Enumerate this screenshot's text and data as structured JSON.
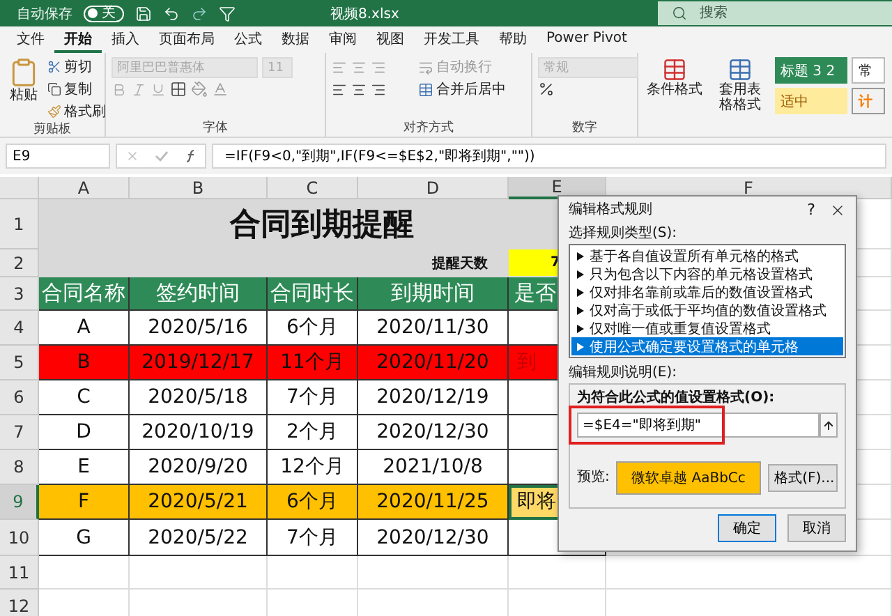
{
  "title_bar": {
    "autosave_label": "自动保存",
    "autosave_toggle": {
      "label": "关",
      "on": false
    },
    "file_name": "视频8.xlsx",
    "search": {
      "placeholder": "搜索"
    }
  },
  "ribbon_tabs": [
    {
      "label": "文件",
      "selected": false
    },
    {
      "label": "开始",
      "selected": true
    },
    {
      "label": "插入",
      "selected": false
    },
    {
      "label": "页面布局",
      "selected": false
    },
    {
      "label": "公式",
      "selected": false
    },
    {
      "label": "数据",
      "selected": false
    },
    {
      "label": "审阅",
      "selected": false
    },
    {
      "label": "视图",
      "selected": false
    },
    {
      "label": "开发工具",
      "selected": false
    },
    {
      "label": "帮助",
      "selected": false
    },
    {
      "label": "Power Pivot",
      "selected": false
    }
  ],
  "ribbon": {
    "clipboard": {
      "paste": "粘贴",
      "cut": "剪切",
      "copy": "复制",
      "format_painter": "格式刷",
      "label": "剪贴板"
    },
    "font": {
      "font_name": "阿里巴巴普惠体",
      "font_size": "11",
      "label": "字体"
    },
    "alignment": {
      "wrap_text": "自动换行",
      "merge_center": "合并后居中",
      "label": "对齐方式"
    },
    "number": {
      "format": "常规",
      "label": "数字"
    },
    "styles": {
      "conditional_format": "条件格式",
      "table_format": "套用表格格式",
      "cell_styles": [
        {
          "label": "标题 3 2",
          "kind": "heading"
        },
        {
          "label": "常",
          "kind": "normal"
        },
        {
          "label": "适中",
          "kind": "neutral"
        },
        {
          "label": "计",
          "kind": "calculation"
        }
      ]
    }
  },
  "formula_bar": {
    "name_box": "E9",
    "formula": "=IF(F9<0,\"到期\",IF(F9<=$E$2,\"即将到期\",\"\"))"
  },
  "sheet": {
    "columns": [
      {
        "label": "A",
        "selected": false
      },
      {
        "label": "B",
        "selected": false
      },
      {
        "label": "C",
        "selected": false
      },
      {
        "label": "D",
        "selected": false
      },
      {
        "label": "E",
        "selected": true
      },
      {
        "label": "F",
        "selected": false
      }
    ],
    "top_row_numbers": [
      "1",
      "2",
      "3"
    ],
    "title": "合同到期提醒",
    "reminder_label": "提醒天数",
    "reminder_days": "7",
    "header": [
      "合同名称",
      "签约时间",
      "合同时长",
      "到期时间",
      "是否"
    ],
    "rows": [
      {
        "number": "4",
        "name": "A",
        "sign_date": "2020/5/16",
        "duration": "6个月",
        "due_date": "2020/11/30",
        "kind": "plain",
        "selected": false
      },
      {
        "number": "5",
        "name": "B",
        "sign_date": "2019/12/17",
        "duration": "11个月",
        "due_date": "2020/11/20",
        "status": "到",
        "kind": "expired",
        "selected": false
      },
      {
        "number": "6",
        "name": "C",
        "sign_date": "2020/5/18",
        "duration": "7个月",
        "due_date": "2020/12/19",
        "kind": "plain",
        "selected": false
      },
      {
        "number": "7",
        "name": "D",
        "sign_date": "2020/10/19",
        "duration": "2个月",
        "due_date": "2020/12/30",
        "kind": "plain",
        "selected": false
      },
      {
        "number": "8",
        "name": "E",
        "sign_date": "2020/9/20",
        "duration": "12个月",
        "due_date": "2021/10/8",
        "kind": "plain",
        "selected": false
      },
      {
        "number": "9",
        "name": "F",
        "sign_date": "2020/5/21",
        "duration": "6个月",
        "due_date": "2020/11/25",
        "status": "即将",
        "kind": "soon",
        "selected": true
      },
      {
        "number": "10",
        "name": "G",
        "sign_date": "2020/5/22",
        "duration": "7个月",
        "due_date": "2020/12/30",
        "kind": "plain",
        "selected": false
      }
    ],
    "blank_row_numbers": [
      "11",
      "12"
    ]
  },
  "dialog": {
    "title": "编辑格式规则",
    "help": "?",
    "rule_type_label": "选择规则类型(S):",
    "rule_types": [
      {
        "label": "基于各自值设置所有单元格的格式",
        "selected": false
      },
      {
        "label": "只为包含以下内容的单元格设置格式",
        "selected": false
      },
      {
        "label": "仅对排名靠前或靠后的数值设置格式",
        "selected": false
      },
      {
        "label": "仅对高于或低于平均值的数值设置格式",
        "selected": false
      },
      {
        "label": "仅对唯一值或重复值设置格式",
        "selected": false
      },
      {
        "label": "使用公式确定要设置格式的单元格",
        "selected": true
      }
    ],
    "description_label": "编辑规则说明(E):",
    "formula_label": "为符合此公式的值设置格式(O):",
    "formula": "=$E4=\"即将到期\"",
    "preview_label": "预览:",
    "preview_text": "微软卓越  AaBbCc",
    "format_button": "格式(F)...",
    "ok": "确定",
    "cancel": "取消"
  }
}
